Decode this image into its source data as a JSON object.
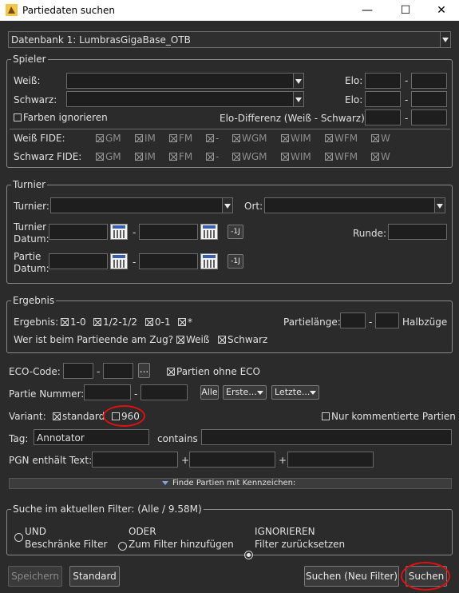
{
  "window": {
    "title": "Partiedaten suchen",
    "min": "—",
    "max": "☐",
    "close": "✕"
  },
  "database": {
    "value": "Datenbank 1: LumbrasGigaBase_OTB"
  },
  "spieler": {
    "group_title": "Spieler",
    "weiss": "Weiß:",
    "schwarz": "Schwarz:",
    "elo1": "Elo:",
    "elo2": "Elo:",
    "dash": "-",
    "farben": "Farben ignorieren",
    "elo_diff": "Elo-Differenz (Weiß - Schwarz):",
    "weiss_fide": "Weiß FIDE:",
    "schwarz_fide": "Schwarz FIDE:",
    "titles": [
      "GM",
      "IM",
      "FM",
      "-",
      "WGM",
      "WIM",
      "WFM",
      "W"
    ]
  },
  "turnier": {
    "group_title": "Turnier",
    "turnier": "Turnier:",
    "ort": "Ort:",
    "turnier_datum_1": "Turnier",
    "turnier_datum_2": "Datum:",
    "partie_datum_1": "Partie",
    "partie_datum_2": "Datum:",
    "runde": "Runde:",
    "minus1": "-1J",
    "dash": "-"
  },
  "ergebnis": {
    "group_title": "Ergebnis",
    "label": "Ergebnis:",
    "opts": [
      "1-0",
      "1/2-1/2",
      "0-1",
      "*"
    ],
    "partielaenge": "Partielänge:",
    "halbzuege": "Halbzüge",
    "zug_label": "Wer ist beim Partieende am Zug?",
    "weiss": "Weiß",
    "schwarz": "Schwarz",
    "dash": "-"
  },
  "eco": {
    "label": "ECO-Code:",
    "ellipsis": "...",
    "ohne": "Partien ohne ECO",
    "dash": "-"
  },
  "nummer": {
    "label": "Partie Nummer:",
    "alle": "Alle",
    "erste": "Erste...",
    "letzte": "Letzte...",
    "dash": "-"
  },
  "variant": {
    "label": "Variant:",
    "standard": "standard",
    "v960": "960",
    "kommentiert": "Nur kommentierte Partien"
  },
  "tag": {
    "label": "Tag:",
    "value": "Annotator",
    "contains": "contains"
  },
  "pgn": {
    "label": "PGN enthält Text:",
    "plus": "+"
  },
  "kennzeichen": {
    "label": "Finde Partien mit Kennzeichen:"
  },
  "filter": {
    "group_title": "Suche im aktuellen Filter: (Alle / 9.58M)",
    "und_1": "UND",
    "und_2": "Beschränke Filter",
    "oder_1": "ODER",
    "oder_2": "Zum Filter hinzufügen",
    "ign_1": "IGNORIEREN",
    "ign_2": "Filter zurücksetzen"
  },
  "buttons": {
    "speichern": "Speichern",
    "standard": "Standard",
    "suchen_neu": "Suchen (Neu Filter)",
    "suchen": "Suchen"
  }
}
